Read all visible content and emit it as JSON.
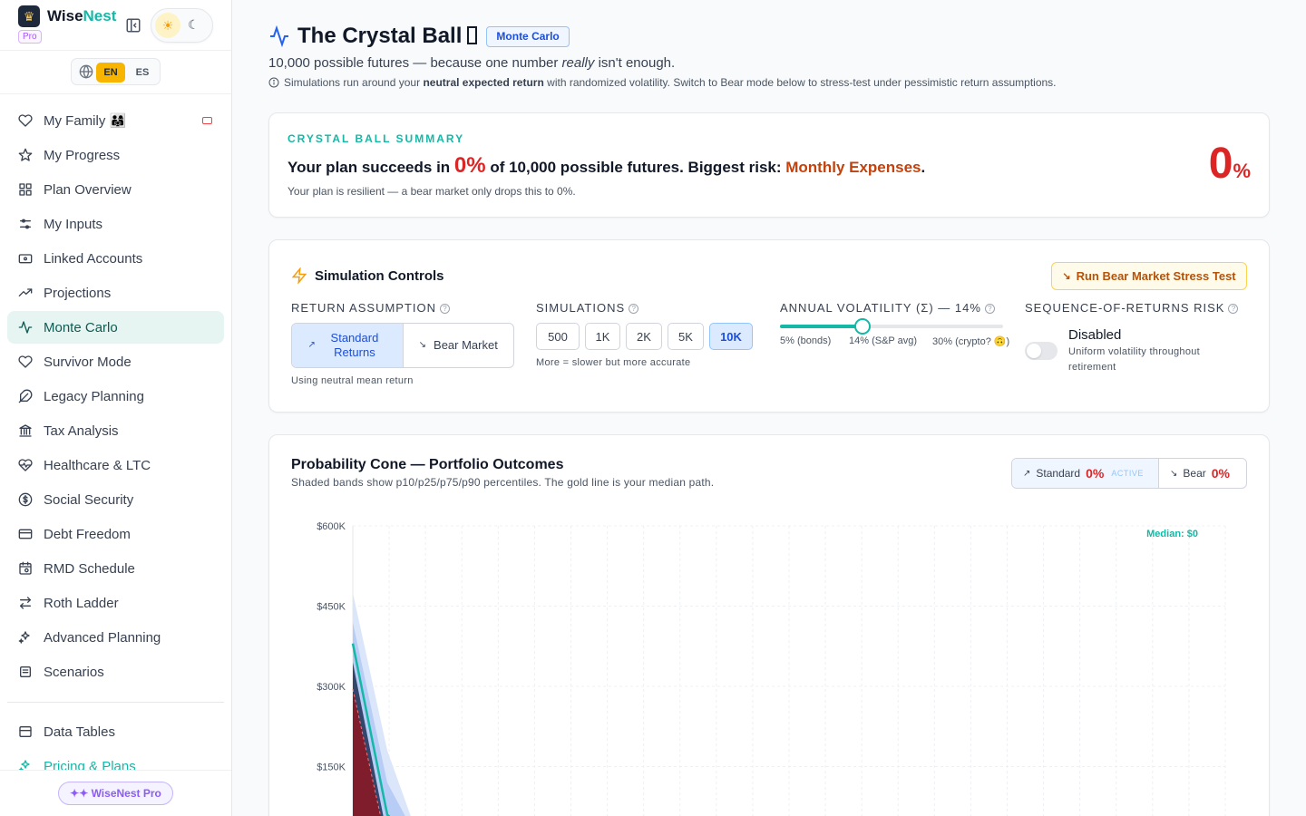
{
  "brand": {
    "name_a": "Wise",
    "name_b": "Nest",
    "tier": "Pro"
  },
  "language": {
    "active": "EN",
    "other": "ES"
  },
  "nav": [
    {
      "label": "My Family 👨‍👩‍👧",
      "icon": "heart-icon",
      "active": false,
      "flag": true
    },
    {
      "label": "My Progress",
      "icon": "star-icon",
      "active": false
    },
    {
      "label": "Plan Overview",
      "icon": "grid-icon",
      "active": false
    },
    {
      "label": "My Inputs",
      "icon": "sliders-icon",
      "active": false
    },
    {
      "label": "Linked Accounts",
      "icon": "wallet-icon",
      "active": false
    },
    {
      "label": "Projections",
      "icon": "trending-up-icon",
      "active": false
    },
    {
      "label": "Monte Carlo",
      "icon": "activity-icon",
      "active": true
    },
    {
      "label": "Survivor Mode",
      "icon": "heart-icon",
      "active": false
    },
    {
      "label": "Legacy Planning",
      "icon": "feather-icon",
      "active": false
    },
    {
      "label": "Tax Analysis",
      "icon": "landmark-icon",
      "active": false
    },
    {
      "label": "Healthcare & LTC",
      "icon": "heart-pulse-icon",
      "active": false
    },
    {
      "label": "Social Security",
      "icon": "dollar-circle-icon",
      "active": false
    },
    {
      "label": "Debt Freedom",
      "icon": "credit-card-icon",
      "active": false
    },
    {
      "label": "RMD Schedule",
      "icon": "calendar-icon",
      "active": false
    },
    {
      "label": "Roth Ladder",
      "icon": "swap-icon",
      "active": false
    },
    {
      "label": "Advanced Planning",
      "icon": "sparkles-icon",
      "active": false
    },
    {
      "label": "Scenarios",
      "icon": "layers-icon",
      "active": false
    }
  ],
  "nav2": [
    {
      "label": "Data Tables",
      "icon": "table-icon"
    },
    {
      "label": "Pricing & Plans",
      "icon": "sparkles-icon"
    }
  ],
  "upgrade_label": "✦✦ WiseNest Pro",
  "page": {
    "title": "The Crystal Ball",
    "badge": "Monte Carlo",
    "subtitle_a": "10,000 possible futures — because one number ",
    "subtitle_em": "really",
    "subtitle_b": " isn't enough.",
    "info_a": "Simulations run around your ",
    "info_b": "neutral expected return",
    "info_c": " with randomized volatility. Switch to Bear mode below to stress-test under pessimistic return assumptions."
  },
  "summary": {
    "label": "CRYSTAL BALL SUMMARY",
    "line_a": "Your plan succeeds in ",
    "pct": "0%",
    "line_b": " of 10,000 possible futures. Biggest risk: ",
    "risk": "Monthly Expenses",
    "line_c": ".",
    "note": "Your plan is resilient — a bear market only drops this to 0%.",
    "big_value": "0",
    "big_unit": "%"
  },
  "controls": {
    "title": "Simulation Controls",
    "bear_button": "Run Bear Market Stress Test",
    "return_label": "RETURN ASSUMPTION",
    "return_options": [
      "Standard Returns",
      "Bear Market"
    ],
    "return_selected": "Standard Returns",
    "return_hint": "Using neutral mean return",
    "sims_label": "SIMULATIONS",
    "sims_options": [
      "500",
      "1K",
      "2K",
      "5K",
      "10K"
    ],
    "sims_selected": "10K",
    "sims_hint": "More = slower but more accurate",
    "vol_label": "ANNUAL VOLATILITY (Σ) — 14%",
    "vol_value": 14,
    "vol_min": 5,
    "vol_max": 30,
    "vol_ticks": [
      "5% (bonds)",
      "14% (S&P avg)",
      "30% (crypto? 🙃)"
    ],
    "seq_label": "SEQUENCE-OF-RETURNS RISK",
    "seq_state": "Disabled",
    "seq_enabled": false,
    "seq_note": "Uniform volatility throughout retirement"
  },
  "cone": {
    "title": "Probability Cone — Portfolio Outcomes",
    "subtitle": "Shaded bands show p10/p25/p75/p90 percentiles. The gold line is your median path.",
    "compare_standard_label": "Standard",
    "compare_standard_value": "0%",
    "compare_active": "ACTIVE",
    "compare_bear_label": "Bear",
    "compare_bear_value": "0%"
  },
  "chart_data": {
    "type": "area",
    "title": "Probability Cone — Portfolio Outcomes",
    "ylim": [
      0,
      600000
    ],
    "y_ticks": [
      "$600K",
      "$450K",
      "$300K",
      "$150K"
    ],
    "y_tick_values": [
      600000,
      450000,
      300000,
      150000
    ],
    "x": [
      0,
      1,
      2
    ],
    "series": [
      {
        "name": "p90",
        "values": [
          475000,
          180000,
          0
        ]
      },
      {
        "name": "p75",
        "values": [
          420000,
          120000,
          0
        ]
      },
      {
        "name": "median",
        "values": [
          380000,
          60000,
          0
        ]
      },
      {
        "name": "p25",
        "values": [
          345000,
          20000,
          0
        ]
      },
      {
        "name": "p10",
        "values": [
          295000,
          0,
          0
        ]
      }
    ],
    "annotation": "Median: $0",
    "grid": true,
    "colors": {
      "p90": "#dbe6fb",
      "p75": "#b8cdf5",
      "median": "#14b8a6",
      "p25": "#34466b",
      "p10": "#7f1d2d"
    }
  }
}
